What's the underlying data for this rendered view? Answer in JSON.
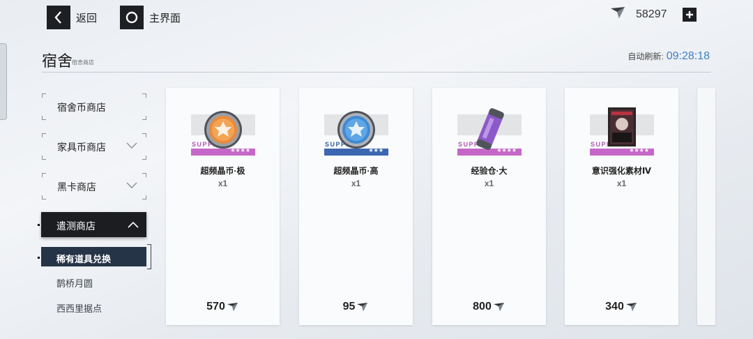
{
  "top_bar": {
    "back_label": "返回",
    "home_label": "主界面",
    "currency_amount": "58297"
  },
  "header": {
    "title": "宿舍",
    "subtitle": "宿舍商店",
    "refresh_label": "自动刷新:",
    "refresh_time": "09:28:18"
  },
  "sidebar": {
    "categories": [
      {
        "label": "宿舍币商店"
      },
      {
        "label": "家具币商店"
      },
      {
        "label": "黑卡商店"
      },
      {
        "label": "遣测商店"
      }
    ],
    "subitems": [
      {
        "label": "稀有道具兑换"
      },
      {
        "label": "鹊桥月圆"
      },
      {
        "label": "西西里据点"
      }
    ]
  },
  "items": [
    {
      "name": "超频晶币·极",
      "qty": "x1",
      "price": "570",
      "supply": "SUPPLY",
      "stars": "★★★★",
      "rarity_color": "#c467c8",
      "supply_color": "#b355b8"
    },
    {
      "name": "超频晶币·高",
      "qty": "x1",
      "price": "95",
      "supply": "SUPPLY",
      "stars": "★★★",
      "rarity_color": "#3c67b0",
      "supply_color": "#2f5ea8"
    },
    {
      "name": "经验仓·大",
      "qty": "x1",
      "price": "800",
      "supply": "SUPPLY",
      "stars": "★★★★",
      "rarity_color": "#c467c8",
      "supply_color": "#b355b8"
    },
    {
      "name": "意识强化素材Ⅳ",
      "qty": "x1",
      "price": "340",
      "supply": "SUPPLY",
      "stars": "★★★★",
      "rarity_color": "#c467c8",
      "supply_color": "#b355b8"
    }
  ],
  "icons": [
    "back-icon",
    "home-icon",
    "crystal-currency-icon",
    "plus-icon",
    "chevron-down-icon",
    "chevron-up-icon"
  ],
  "colors": {
    "accent_time": "#3d7fc1",
    "active_category_bg": "#1b1d21",
    "active_sub_bg": "#263447"
  }
}
